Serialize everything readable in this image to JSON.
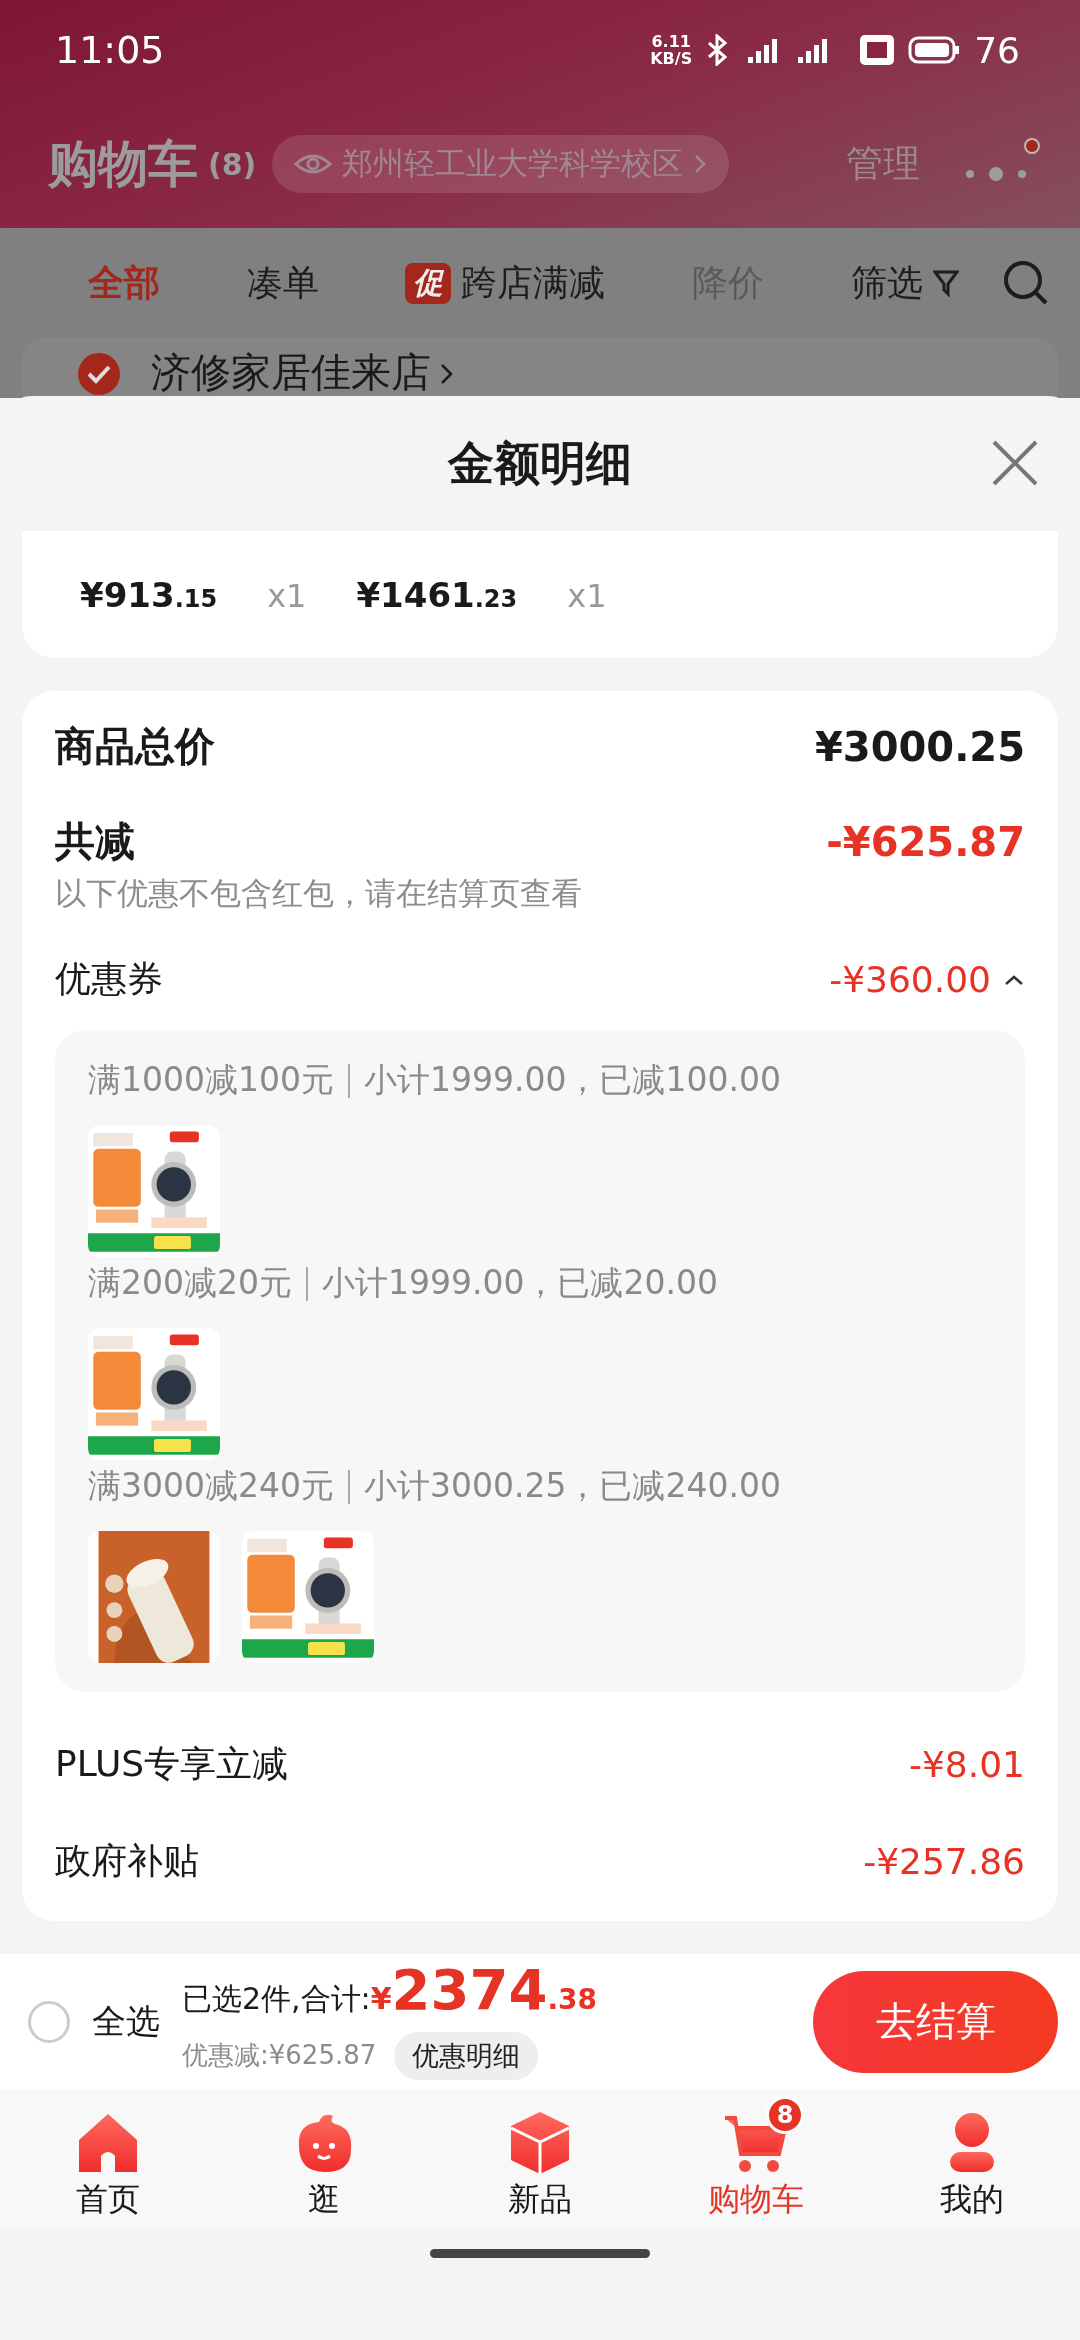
{
  "status_bar": {
    "time": "11:05",
    "net_speed_value": "6.11",
    "net_speed_unit": "KB/S",
    "battery": "76"
  },
  "header": {
    "title": "购物车",
    "count": "(8)",
    "location": "郑州轻工业大学科学校区",
    "manage": "管理",
    "more_badge": true
  },
  "filter_tabs": [
    {
      "kind": "plain",
      "label": "全部",
      "selected": true,
      "disabled": false
    },
    {
      "kind": "plain",
      "label": "凑单",
      "selected": false,
      "disabled": false
    },
    {
      "kind": "promo",
      "badge": "促",
      "label": "跨店满减",
      "selected": false,
      "disabled": false
    },
    {
      "kind": "plain",
      "label": "降价",
      "selected": false,
      "disabled": true
    },
    {
      "kind": "filter",
      "label": "筛选",
      "selected": false,
      "disabled": false
    }
  ],
  "store": {
    "name": "济修家居佳来店",
    "checked": true
  },
  "sheet": {
    "title": "金额明细",
    "items": [
      {
        "price_int": "¥913",
        "price_dec": ".15",
        "qty": "x1"
      },
      {
        "price_int": "¥1461",
        "price_dec": ".23",
        "qty": "x1"
      }
    ],
    "summary": {
      "total_label": "商品总价",
      "total": "¥3000.25",
      "discount_label": "共减",
      "discount": "-¥625.87",
      "note": "以下优惠不包含红包，请在结算页查看"
    },
    "coupons": {
      "label": "优惠券",
      "amount": "-¥360.00",
      "expanded": true,
      "groups": [
        {
          "rule": "满1000减100元",
          "detail": "小计1999.00，已减100.00"
        },
        {
          "rule": "满200减20元",
          "detail": "小计1999.00，已减20.00"
        },
        {
          "rule": "满3000减240元",
          "detail": "小计3000.25，已减240.00"
        }
      ]
    },
    "extras": [
      {
        "label": "PLUS专享立减",
        "amount": "-¥8.01"
      },
      {
        "label": "政府补贴",
        "amount": "-¥257.86"
      }
    ]
  },
  "checkout": {
    "select_all_label": "全选",
    "select_all_checked": false,
    "selected_text": "已选2件,合计:",
    "currency": "¥",
    "total_int": "2374",
    "total_dec": ".38",
    "saved": "优惠减:¥625.87",
    "detail_button": "优惠明细",
    "submit": "去结算"
  },
  "nav": [
    {
      "kind": "home",
      "label": "首页",
      "selected": false
    },
    {
      "kind": "explore",
      "label": "逛",
      "selected": false
    },
    {
      "kind": "new",
      "label": "新品",
      "selected": false
    },
    {
      "kind": "cart",
      "label": "购物车",
      "selected": true,
      "badge": "8"
    },
    {
      "kind": "profile",
      "label": "我的",
      "selected": false
    }
  ]
}
